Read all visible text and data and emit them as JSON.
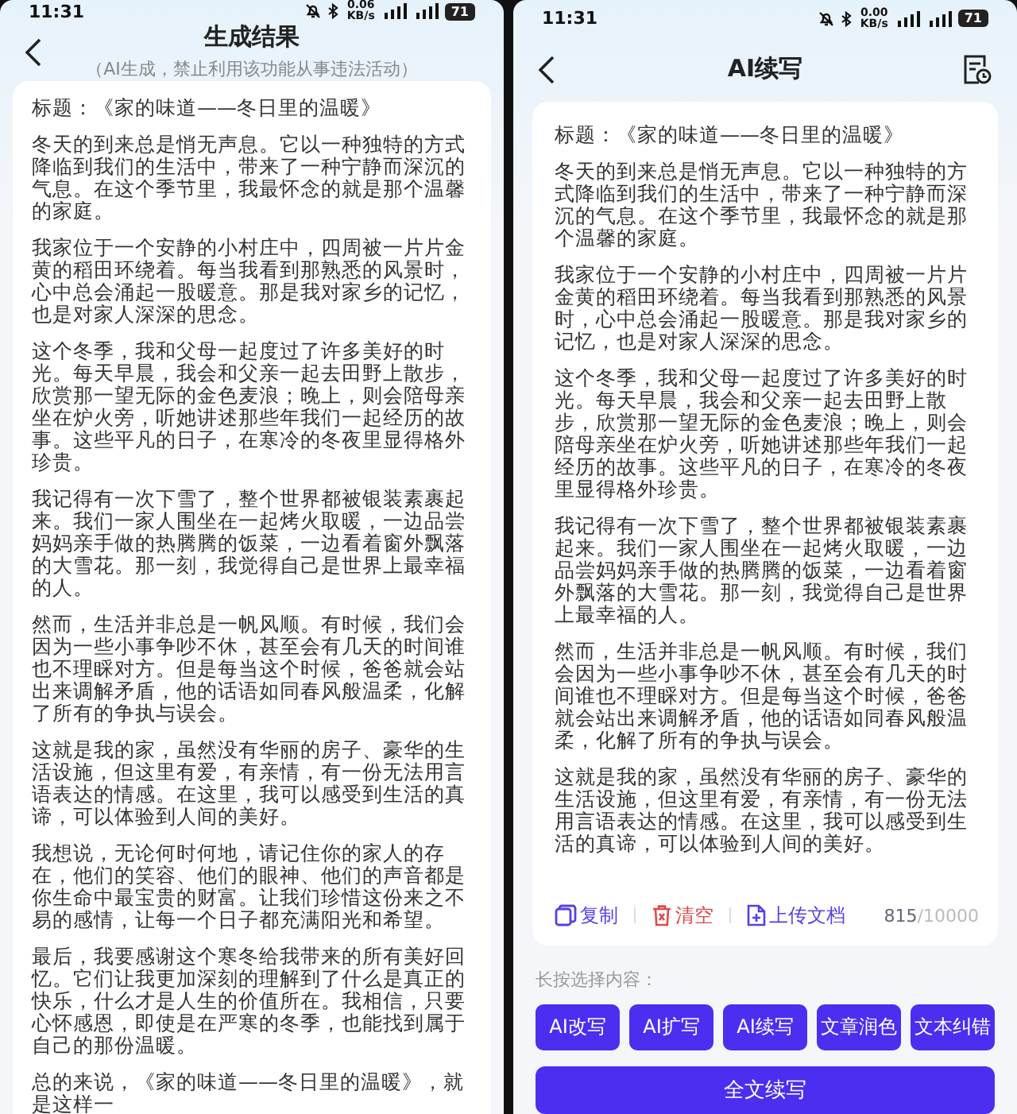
{
  "screens": [
    {
      "status_bar": {
        "time": "11:31",
        "speed": "0.06",
        "speed_unit": "KB/s",
        "battery": "71"
      },
      "header": {
        "title": "生成结果",
        "subtitle": "（AI生成，禁止利用该功能从事违法活动）"
      },
      "article": {
        "paragraphs": [
          "标题：《家的味道——冬日里的温暖》",
          "冬天的到来总是悄无声息。它以一种独特的方式降临到我们的生活中，带来了一种宁静而深沉的气息。在这个季节里，我最怀念的就是那个温馨的家庭。",
          "我家位于一个安静的小村庄中，四周被一片片金黄的稻田环绕着。每当我看到那熟悉的风景时，心中总会涌起一股暖意。那是我对家乡的记忆，也是对家人深深的思念。",
          "这个冬季，我和父母一起度过了许多美好的时光。每天早晨，我会和父亲一起去田野上散步，欣赏那一望无际的金色麦浪；晚上，则会陪母亲坐在炉火旁，听她讲述那些年我们一起经历的故事。这些平凡的日子，在寒冷的冬夜里显得格外珍贵。",
          "我记得有一次下雪了，整个世界都被银装素裹起来。我们一家人围坐在一起烤火取暖，一边品尝妈妈亲手做的热腾腾的饭菜，一边看着窗外飘落的大雪花。那一刻，我觉得自己是世界上最幸福的人。",
          "然而，生活并非总是一帆风顺。有时候，我们会因为一些小事争吵不休，甚至会有几天的时间谁也不理睬对方。但是每当这个时候，爸爸就会站出来调解矛盾，他的话语如同春风般温柔，化解了所有的争执与误会。",
          "这就是我的家，虽然没有华丽的房子、豪华的生活设施，但这里有爱，有亲情，有一份无法用言语表达的情感。在这里，我可以感受到生活的真谛，可以体验到人间的美好。",
          "我想说，无论何时何地，请记住你的家人的存在，他们的笑容、他们的眼神、他们的声音都是你生命中最宝贵的财富。让我们珍惜这份来之不易的感情，让每一个日子都充满阳光和希望。",
          "最后，我要感谢这个寒冬给我带来的所有美好回忆。它们让我更加深刻的理解到了什么是真正的快乐，什么才是人生的价值所在。我相信，只要心怀感恩，即使是在严寒的冬季，也能找到属于自己的那份温暖。",
          "总的来说，《家的味道——冬日里的温暖》，就是这样一"
        ]
      }
    },
    {
      "status_bar": {
        "time": "11:31",
        "speed": "0.00",
        "speed_unit": "KB/s",
        "battery": "71"
      },
      "header": {
        "title": "AI续写"
      },
      "article": {
        "paragraphs": [
          "标题：《家的味道——冬日里的温暖》",
          "冬天的到来总是悄无声息。它以一种独特的方式降临到我们的生活中，带来了一种宁静而深沉的气息。在这个季节里，我最怀念的就是那个温馨的家庭。",
          "我家位于一个安静的小村庄中，四周被一片片金黄的稻田环绕着。每当我看到那熟悉的风景时，心中总会涌起一股暖意。那是我对家乡的记忆，也是对家人深深的思念。",
          "这个冬季，我和父母一起度过了许多美好的时光。每天早晨，我会和父亲一起去田野上散步，欣赏那一望无际的金色麦浪；晚上，则会陪母亲坐在炉火旁，听她讲述那些年我们一起经历的故事。这些平凡的日子，在寒冷的冬夜里显得格外珍贵。",
          "我记得有一次下雪了，整个世界都被银装素裹起来。我们一家人围坐在一起烤火取暖，一边品尝妈妈亲手做的热腾腾的饭菜，一边看着窗外飘落的大雪花。那一刻，我觉得自己是世界上最幸福的人。",
          "然而，生活并非总是一帆风顺。有时候，我们会因为一些小事争吵不休，甚至会有几天的时间谁也不理睬对方。但是每当这个时候，爸爸就会站出来调解矛盾，他的话语如同春风般温柔，化解了所有的争执与误会。",
          "这就是我的家，虽然没有华丽的房子、豪华的生活设施，但这里有爱，有亲情，有一份无法用言语表达的情感。在这里，我可以感受到生活的真谛，可以体验到人间的美好。"
        ],
        "toolbar": {
          "actions": [
            {
              "kind": "copy",
              "label": "复制"
            },
            {
              "kind": "clear",
              "label": "清空"
            },
            {
              "kind": "upload",
              "label": "上传文档"
            }
          ],
          "count": "815",
          "limit": "/10000"
        }
      },
      "hint": "长按选择内容：",
      "quick_actions": [
        "AI改写",
        "AI扩写",
        "AI续写",
        "文章润色",
        "文本纠错"
      ],
      "primary_button": "全文续写"
    }
  ]
}
